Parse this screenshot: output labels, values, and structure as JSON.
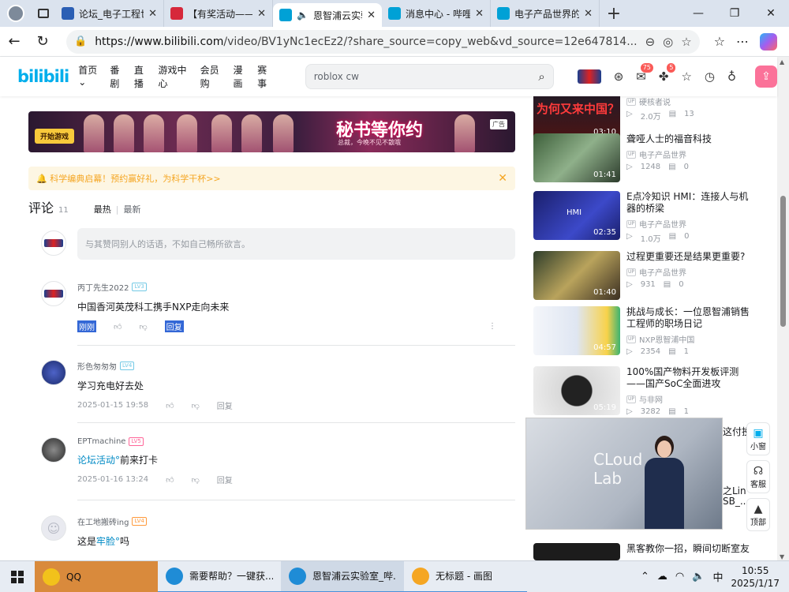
{
  "browser": {
    "tabs": [
      {
        "title": "论坛_电子工程世界",
        "favicon_color": "#2b5fb4",
        "active": false
      },
      {
        "title": "【有奖活动——",
        "favicon_color": "#d6283b",
        "active": false
      },
      {
        "title": "恩智浦云实验室",
        "favicon_color": "#00a1d6",
        "active": true
      },
      {
        "title": "消息中心 - 哔哩",
        "favicon_color": "#00a1d6",
        "active": false
      },
      {
        "title": "电子产品世界的",
        "favicon_color": "#00a1d6",
        "active": false
      }
    ],
    "new_tab": "+",
    "url_host": "https://www.bilibili.com",
    "url_path": "/video/BV1yNc1ecEz2/?share_source=copy_web&vd_source=12e647814..."
  },
  "site": {
    "logo": "bilibili",
    "nav": [
      "首页",
      "番剧",
      "直播",
      "游戏中心",
      "会员购",
      "漫画",
      "赛事"
    ],
    "nav_first_arrow": "⌄",
    "search_placeholder": "roblox cw",
    "badges": {
      "messages": "75",
      "dynamics": "5"
    }
  },
  "ad": {
    "button": "开始游戏",
    "headline": "秘书等你约",
    "sub": "总裁，今晚不见不散哦",
    "label": "广告"
  },
  "notice": {
    "text": "🔔 科学编典启幕！预约赢好礼，为科学干杯>>"
  },
  "comments_header": {
    "title": "评论",
    "count": "11",
    "sort_hot": "最热",
    "sep": "|",
    "sort_new": "最新"
  },
  "reply_placeholder": "与其赞同别人的话语，不如自己畅所欲言。",
  "comments": [
    {
      "user": "丙丁先生2022",
      "level": "LV3",
      "text": "中国香河英茂科工携手NXP走向未来",
      "time": "刚刚",
      "reply": "回复",
      "more": "⋮"
    },
    {
      "user": "形色匆匆匆",
      "level": "LV4",
      "text": "学习充电好去处",
      "time": "2025-01-15 19:58",
      "reply": "回复"
    },
    {
      "user": "EPTmachine",
      "level": "LV5",
      "link": "论坛活动",
      "text_after": "前来打卡",
      "time": "2025-01-16 13:24",
      "reply": "回复"
    },
    {
      "user": "在工地搬砖ing",
      "level": "LV4",
      "text_before": "这是",
      "link": "牢脸",
      "text_after": "吗",
      "time": ""
    }
  ],
  "recommendations": [
    {
      "title": "为何又来中国？",
      "up": "硬核者说",
      "views": "2.0万",
      "comments": "13",
      "duration": "03:10"
    },
    {
      "title": "聋哑人士的福音科技",
      "up": "电子产品世界",
      "views": "1248",
      "comments": "0",
      "duration": "01:41"
    },
    {
      "title": "E点冷知识 HMI：连接人与机器的桥梁",
      "up": "电子产品世界",
      "views": "1.0万",
      "comments": "0",
      "duration": "02:35"
    },
    {
      "title": "过程更重要还是结果更重要?",
      "up": "电子产品世界",
      "views": "931",
      "comments": "0",
      "duration": "01:40"
    },
    {
      "title": "挑战与成长：一位恩智浦销售工程师的职场日记",
      "up": "NXP恩智浦中国",
      "views": "2354",
      "comments": "1",
      "duration": "04:57"
    },
    {
      "title": "100%国产物料开发板评测——国产SoC全面进攻",
      "up": "与非网",
      "views": "3282",
      "comments": "1",
      "duration": "05:19"
    },
    {
      "title": "黑客教你一招，瞬间切断室友",
      "up": "",
      "views": "",
      "comments": "",
      "duration": ""
    }
  ],
  "floating_video": {
    "text_line1": "CLoud",
    "text_line2": "Lab",
    "peek_right_1": "这付投",
    "peek_right_2": "之Lin",
    "peek_right_3": "SB_..."
  },
  "side_buttons": [
    {
      "label": "小窗",
      "icon": "▣"
    },
    {
      "label": "客服",
      "icon": "☊"
    },
    {
      "label": "顶部",
      "icon": "▲"
    }
  ],
  "taskbar": {
    "apps": [
      {
        "label": "QQ",
        "color": "#f2c21b"
      },
      {
        "label": "需要帮助？一键获...",
        "color": "#1f8cd6"
      },
      {
        "label": "恩智浦云实验室_哔...",
        "color": "#1f8cd6"
      },
      {
        "label": "无标题 - 画图",
        "color": "#f5a623"
      }
    ],
    "time": "10:55",
    "date": "2025/1/17",
    "ime": "中"
  }
}
